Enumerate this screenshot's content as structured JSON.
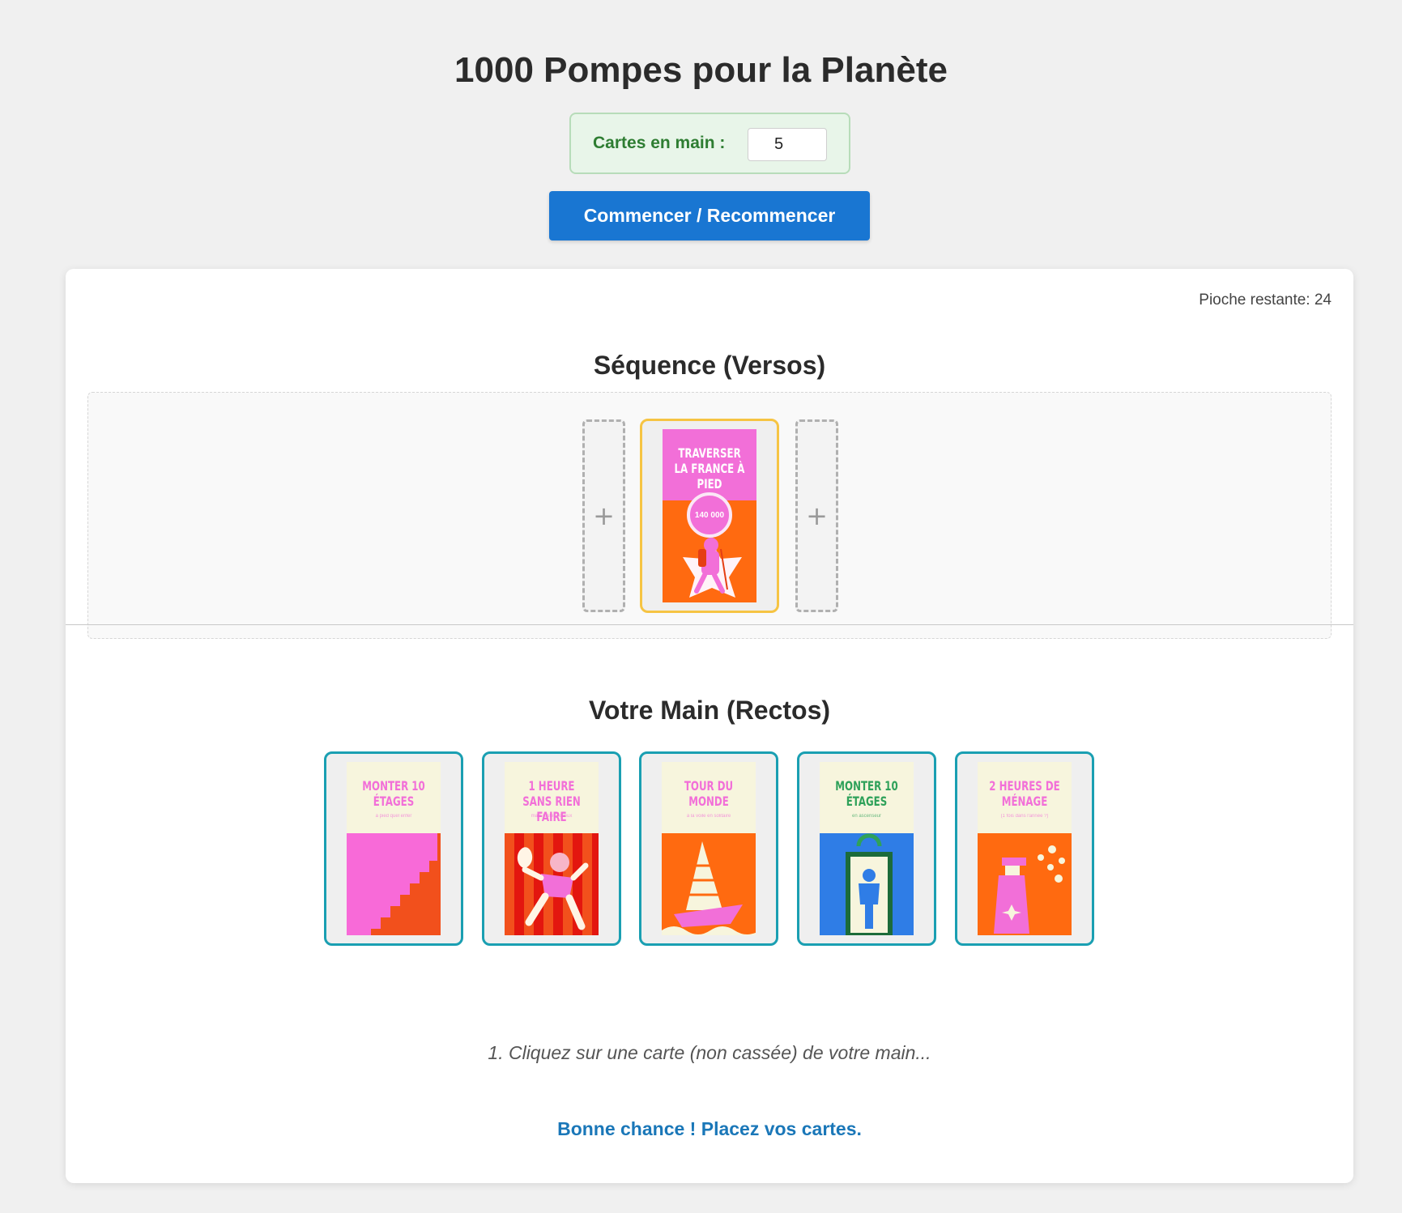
{
  "header": {
    "title": "1000 Pompes pour la Planète",
    "hand_count_label": "Cartes en main :",
    "hand_count_value": "5",
    "start_button_label": "Commencer / Recommencer"
  },
  "board": {
    "deck_remaining": "Pioche restante: 24",
    "sequence_title": "Séquence (Versos)",
    "hand_title": "Votre Main (Rectos)",
    "slot_symbol": "+",
    "sequence_cards": [
      {
        "title": "TRAVERSER LA FRANCE À PIED",
        "value": "140 000",
        "selected": true
      }
    ],
    "hand_cards": [
      {
        "title": "MONTER 10 ÉTAGES",
        "subtitle": "à pied quel enfer",
        "color": "#f26fd8"
      },
      {
        "title": "1 HEURE SANS RIEN FAIRE",
        "subtitle": "mais rester sérieux",
        "color": "#f26fd8"
      },
      {
        "title": "TOUR DU MONDE",
        "subtitle": "à la voile en solitaire",
        "color": "#f26fd8"
      },
      {
        "title": "MONTER 10 ÉTAGES",
        "subtitle": "en ascenseur",
        "color": "#2fa15a"
      },
      {
        "title": "2 HEURES DE MÉNAGE",
        "subtitle": "(1 fois dans l'année ?)",
        "color": "#f26fd8"
      }
    ],
    "instruction": "1. Cliquez sur une carte (non cassée) de votre main...",
    "status_message": "Bonne chance ! Placez vos cartes."
  },
  "colors": {
    "primary_button": "#1976d2",
    "hand_card_border": "#1a9fb2",
    "selected_card_border": "#f6c443",
    "status_text": "#1a77b8",
    "label_green": "#2e7d32"
  }
}
